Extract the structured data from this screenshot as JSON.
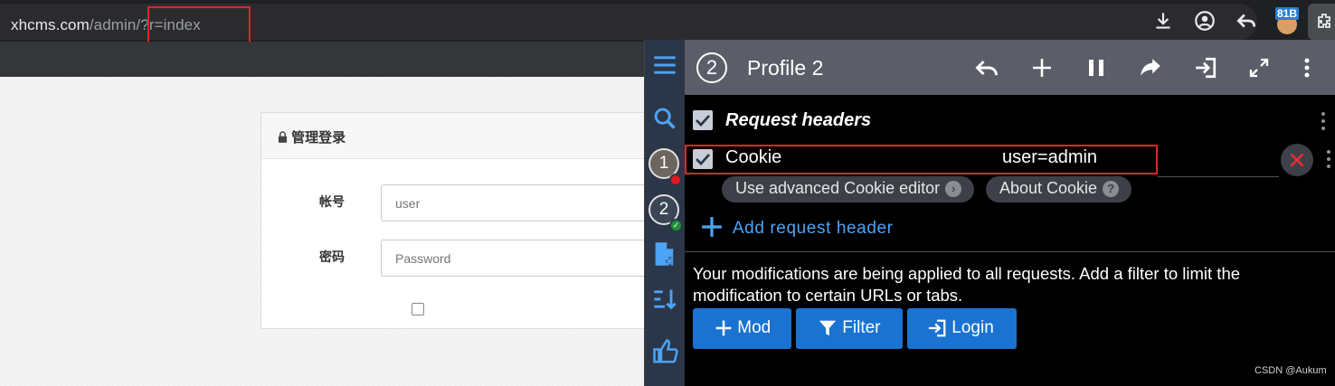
{
  "browser": {
    "url_host": "xhcms.com",
    "url_path": "/admin/?r=index",
    "extension_badge": "81B"
  },
  "page": {
    "login_title": "管理登录",
    "username_label": "帐号",
    "username_placeholder": "user",
    "password_label": "密码",
    "password_placeholder": "Password"
  },
  "modheader": {
    "profile_number": "2",
    "profile_name": "Profile 2",
    "sidebar_profiles": [
      "1",
      "2"
    ],
    "section_title": "Request headers",
    "header_name": "Cookie",
    "header_value": "user=admin",
    "chip_advanced": "Use advanced Cookie editor",
    "chip_about": "About Cookie",
    "add_header_label": "Add request header",
    "info_text": "Your modifications are being applied to all requests. Add a filter to limit the modification to certain URLs or tabs.",
    "buttons": [
      "Mod",
      "Filter",
      "Login"
    ],
    "accent": "#1a73d1"
  },
  "watermark": "CSDN @Aukum"
}
